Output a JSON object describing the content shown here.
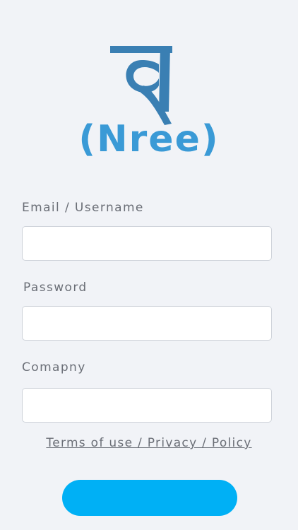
{
  "logo": {
    "glyph_name": "nree-glyph-logo",
    "text": "(Nree)",
    "colors": {
      "glyph": "#3a7fb3",
      "text": "#3a9ad6"
    }
  },
  "form": {
    "email_label": "Email / Username",
    "email_value": "",
    "password_label": "Password",
    "password_value": "",
    "company_label": "Comapny",
    "company_value": ""
  },
  "terms_link": "Terms of use / Privacy / Policy",
  "submit": {
    "label": "",
    "color": "#00b0f5"
  }
}
